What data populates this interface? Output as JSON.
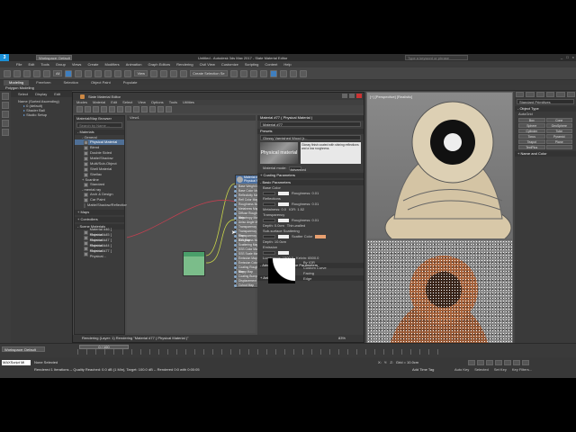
{
  "window": {
    "title": "Untitled - Autodesk 3ds Max 2017  -  Slate Material Editor",
    "workspace_field": "Workspace: Default",
    "search_placeholder": "Type a keyword or phrase",
    "min": "_",
    "max": "□",
    "close": "×"
  },
  "menubar": [
    "File",
    "Edit",
    "Tools",
    "Group",
    "Views",
    "Create",
    "Modifiers",
    "Animation",
    "Graph Editors",
    "Rendering",
    "Civil View",
    "Customize",
    "Scripting",
    "Content",
    "Help"
  ],
  "toolbar": {
    "view_dropdown": "View",
    "selection_set": "Create Selection Se"
  },
  "ribbon": {
    "tabs": [
      "Modeling",
      "Freeform",
      "Selection",
      "Object Paint",
      "Populate"
    ],
    "active": "Modeling",
    "sub": "Polygon Modeling"
  },
  "scene_explorer": {
    "tabs": [
      "Select",
      "Display",
      "Edit"
    ],
    "sorted": "Name (Sorted Ascending)",
    "items": [
      "0 (default)",
      "Shader Ball",
      "Studio Setup"
    ]
  },
  "slate": {
    "title": "Slate Material Editor",
    "menus": [
      "Modes",
      "Material",
      "Edit",
      "Select",
      "View",
      "Options",
      "Tools",
      "Utilities"
    ],
    "browser": {
      "title": "Material/Map Browser",
      "search": "Search by Name ...",
      "sections": [
        {
          "name": "- Materials",
          "sub": "- General",
          "items": [
            "Physical Material",
            "Blend",
            "Double Sided",
            "Matte/Shadow",
            "Multi/Sub-Object",
            "Shell Material",
            "Shellac"
          ]
        },
        {
          "name": "",
          "sub": "+ Scanline",
          "items": [
            "Standard"
          ]
        },
        {
          "name": "",
          "sub": "- mental ray",
          "items": [
            "Arch & Design",
            "Car Paint",
            "Matte/Shadow/Reflection"
          ]
        }
      ],
      "maps": "+ Maps",
      "controllers": "+ Controllers",
      "scene_materials": "- Scene Materials",
      "scene_items": [
        "Material #46 [ Physical...",
        "Material #45 [ Physical...",
        "Material #47 [ Physical...",
        "Material #44 [ Physical...",
        "Material #77 [ Physical..."
      ]
    },
    "view_tab": "View1",
    "node": {
      "title": "Material #77",
      "sub": "Physical M...",
      "slots": [
        "Base Weight Map",
        "Base Color Map",
        "Reflectivity Map",
        "Refl Color Map",
        "Roughness Map",
        "Metalness Map",
        "Diffuse Roughness Map",
        "Anisotropy Map",
        "Aniso Angle Map",
        "Transparency Map",
        "Transparency Color Map",
        "Transparency Roughness Map",
        "IOR Map",
        "Scattering Map",
        "SSS Color Map",
        "SSS Scale Map",
        "Emission Map",
        "Emission Color Map",
        "Coating Roughness Map",
        "Bump Map",
        "Coating Bump Map",
        "Displacement Map",
        "Cutout Map"
      ]
    },
    "params": {
      "title": "Material #77 ( Physical Material )",
      "name": "Material #77",
      "presets": "Presets",
      "preset_name": "Glossy Varnished Wood (r...",
      "preset_img": "Physical material",
      "preset_desc": "Glossy finish coated with shining reflections and a low roughness.",
      "material_mode_label": "Material mode:",
      "material_mode": "Advanced",
      "coating": "+ Coating Parameters",
      "basic": "- Basic Parameters",
      "rows": [
        "Base Color",
        "Reflections",
        "Metalness: 0.0",
        "Transparency",
        "Depth: 0.0cm",
        "Sub-surface Scattering",
        "Depth: 10.0cm",
        "Emission",
        "Luminance: 1500.0"
      ],
      "roughness": "Roughness: 0.01",
      "ior": "IOR: 1.52",
      "thin_walled": "Thin-walled",
      "scatter_color": "Scatter Color",
      "kelvin": "Kelvin: 6500.0",
      "advanced": "- Advanced Reflectance Parameters",
      "by_ior": "By IOR",
      "custom_curve": "Custom Curve",
      "facing": "Facing",
      "edge": "Edge",
      "anisotropy": "+ Anisotropy"
    },
    "status": "Rendering (Layer: 1) Rendering \"Material #77 ( Physical Material )\"",
    "zoom": "83%"
  },
  "viewports": {
    "top_label": "[+] [Perspective] [Realistic]"
  },
  "command_panel": {
    "dropdown": "Standard Primitives",
    "object_type": "- Object Type",
    "autogrid": "AutoGrid",
    "buttons": [
      "Box",
      "Cone",
      "Sphere",
      "GeoSphere",
      "Cylinder",
      "Tube",
      "Torus",
      "Pyramid",
      "Teapot",
      "Plane",
      "TextPlus",
      ""
    ],
    "name_color": "+ Name and Color"
  },
  "timeline": {
    "workspace": "Workspace: Default",
    "slider": "0 / 100"
  },
  "status": {
    "listener": "MAXScript Mi",
    "none_selected": "None Selected",
    "rendering": "Rendered 1 Iterations -- Quality Reached: 0.0 dB (1 Min), Target: 100.0 dB -- Rendered 0:0 with 0:00:05",
    "x": "X:",
    "y": "Y:",
    "z": "Z:",
    "grid": "Grid = 10.0cm",
    "add_tag": "Add Time Tag",
    "autokey": "Auto Key",
    "selected": "Selected",
    "setkey": "Set Key",
    "filters": "Key Filters..."
  }
}
